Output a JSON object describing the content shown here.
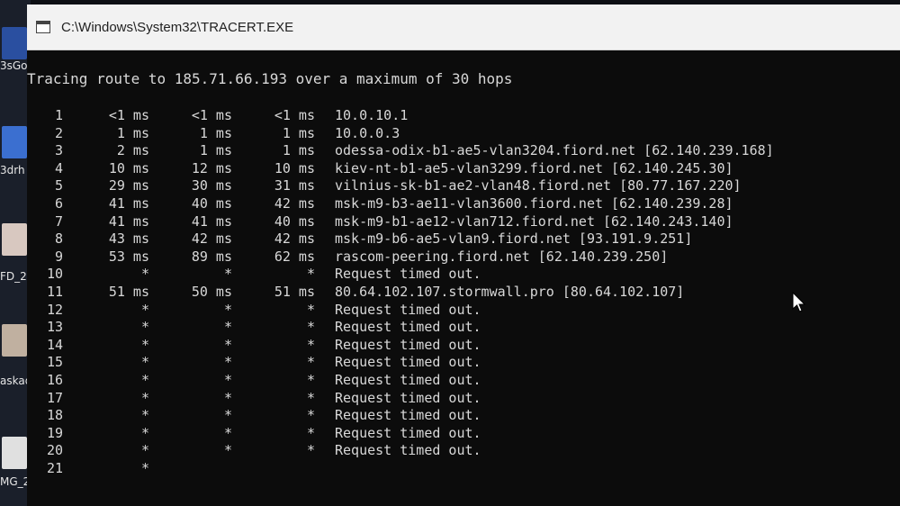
{
  "desktop": {
    "items": [
      {
        "label": "3sGo",
        "color": "#2a4fa0"
      },
      {
        "label": "3drh",
        "color": "#3b6fd0"
      },
      {
        "label": "FD_2",
        "color": "#d8c8c0"
      },
      {
        "label": "askad",
        "color": "#c0b0a0"
      },
      {
        "label": "MG_2",
        "color": "#e0e0e0"
      }
    ]
  },
  "window": {
    "title": "C:\\Windows\\System32\\TRACERT.EXE"
  },
  "console": {
    "header": "Tracing route to 185.71.66.193 over a maximum of 30 hops",
    "hops": [
      {
        "hop": "1",
        "t1": "<1 ms",
        "t2": "<1 ms",
        "t3": "<1 ms",
        "host": "10.0.10.1"
      },
      {
        "hop": "2",
        "t1": "1 ms",
        "t2": "1 ms",
        "t3": "1 ms",
        "host": "10.0.0.3"
      },
      {
        "hop": "3",
        "t1": "2 ms",
        "t2": "1 ms",
        "t3": "1 ms",
        "host": "odessa-odix-b1-ae5-vlan3204.fiord.net [62.140.239.168]"
      },
      {
        "hop": "4",
        "t1": "10 ms",
        "t2": "12 ms",
        "t3": "10 ms",
        "host": "kiev-nt-b1-ae5-vlan3299.fiord.net [62.140.245.30]"
      },
      {
        "hop": "5",
        "t1": "29 ms",
        "t2": "30 ms",
        "t3": "31 ms",
        "host": "vilnius-sk-b1-ae2-vlan48.fiord.net [80.77.167.220]"
      },
      {
        "hop": "6",
        "t1": "41 ms",
        "t2": "40 ms",
        "t3": "42 ms",
        "host": "msk-m9-b3-ae11-vlan3600.fiord.net [62.140.239.28]"
      },
      {
        "hop": "7",
        "t1": "41 ms",
        "t2": "41 ms",
        "t3": "40 ms",
        "host": "msk-m9-b1-ae12-vlan712.fiord.net [62.140.243.140]"
      },
      {
        "hop": "8",
        "t1": "43 ms",
        "t2": "42 ms",
        "t3": "42 ms",
        "host": "msk-m9-b6-ae5-vlan9.fiord.net [93.191.9.251]"
      },
      {
        "hop": "9",
        "t1": "53 ms",
        "t2": "89 ms",
        "t3": "62 ms",
        "host": "rascom-peering.fiord.net [62.140.239.250]"
      },
      {
        "hop": "10",
        "t1": "*",
        "t2": "*",
        "t3": "*",
        "host": "Request timed out."
      },
      {
        "hop": "11",
        "t1": "51 ms",
        "t2": "50 ms",
        "t3": "51 ms",
        "host": "80.64.102.107.stormwall.pro [80.64.102.107]"
      },
      {
        "hop": "12",
        "t1": "*",
        "t2": "*",
        "t3": "*",
        "host": "Request timed out."
      },
      {
        "hop": "13",
        "t1": "*",
        "t2": "*",
        "t3": "*",
        "host": "Request timed out."
      },
      {
        "hop": "14",
        "t1": "*",
        "t2": "*",
        "t3": "*",
        "host": "Request timed out."
      },
      {
        "hop": "15",
        "t1": "*",
        "t2": "*",
        "t3": "*",
        "host": "Request timed out."
      },
      {
        "hop": "16",
        "t1": "*",
        "t2": "*",
        "t3": "*",
        "host": "Request timed out."
      },
      {
        "hop": "17",
        "t1": "*",
        "t2": "*",
        "t3": "*",
        "host": "Request timed out."
      },
      {
        "hop": "18",
        "t1": "*",
        "t2": "*",
        "t3": "*",
        "host": "Request timed out."
      },
      {
        "hop": "19",
        "t1": "*",
        "t2": "*",
        "t3": "*",
        "host": "Request timed out."
      },
      {
        "hop": "20",
        "t1": "*",
        "t2": "*",
        "t3": "*",
        "host": "Request timed out."
      },
      {
        "hop": "21",
        "t1": "*",
        "t2": "",
        "t3": "",
        "host": ""
      }
    ]
  },
  "colors": {
    "console_bg": "#0c0c0c",
    "console_text": "#d8d8d8",
    "titlebar_bg": "#f2f2f2"
  }
}
